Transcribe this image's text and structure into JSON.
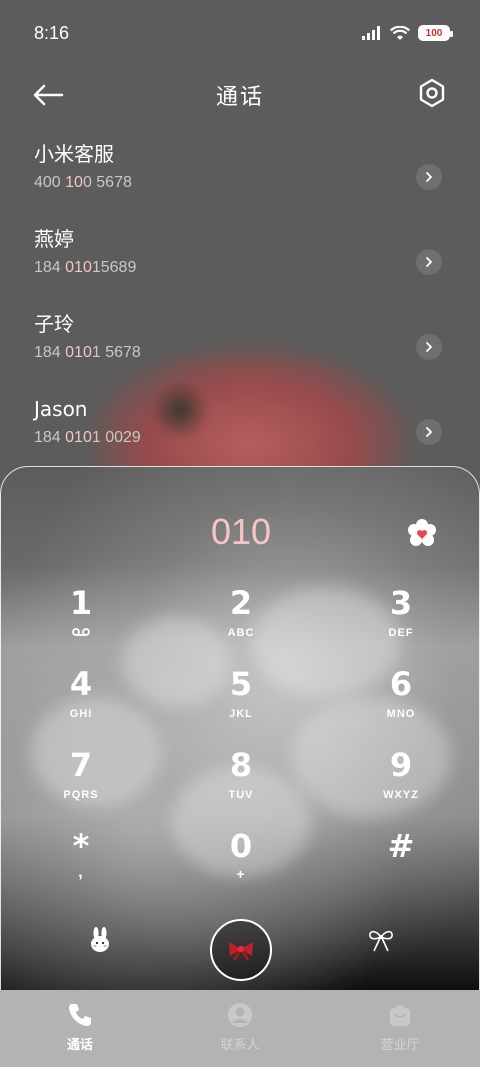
{
  "status_bar": {
    "time": "8:16",
    "battery": "100"
  },
  "header": {
    "title": "通话"
  },
  "calls": [
    {
      "name": "小米客服",
      "number_parts": [
        "400 ",
        "10",
        "0 5678"
      ]
    },
    {
      "name": "燕婷",
      "number_parts": [
        "184 ",
        "010",
        "15689"
      ]
    },
    {
      "name": "子玲",
      "number_parts": [
        "184 ",
        "010",
        "1 5678"
      ]
    },
    {
      "name": "Jason",
      "number_parts": [
        "184 ",
        "010",
        "1 0029"
      ]
    }
  ],
  "dialpad": {
    "display": "010",
    "keys": [
      {
        "digit": "1",
        "letters": ""
      },
      {
        "digit": "2",
        "letters": "ABC"
      },
      {
        "digit": "3",
        "letters": "DEF"
      },
      {
        "digit": "4",
        "letters": "GHI"
      },
      {
        "digit": "5",
        "letters": "JKL"
      },
      {
        "digit": "6",
        "letters": "MNO"
      },
      {
        "digit": "7",
        "letters": "PQRS"
      },
      {
        "digit": "8",
        "letters": "TUV"
      },
      {
        "digit": "9",
        "letters": "WXYZ"
      },
      {
        "digit": "*",
        "letters": ","
      },
      {
        "digit": "0",
        "letters": "+"
      },
      {
        "digit": "#",
        "letters": ""
      }
    ]
  },
  "nav": [
    {
      "label": "通话",
      "icon": "phone-icon",
      "active": true
    },
    {
      "label": "联系人",
      "icon": "contact-icon",
      "active": false
    },
    {
      "label": "营业厅",
      "icon": "store-icon",
      "active": false
    }
  ],
  "colors": {
    "accent": "#f6c6c6",
    "background": "#5c5c5c",
    "nav_background": "#b3b3b3"
  }
}
